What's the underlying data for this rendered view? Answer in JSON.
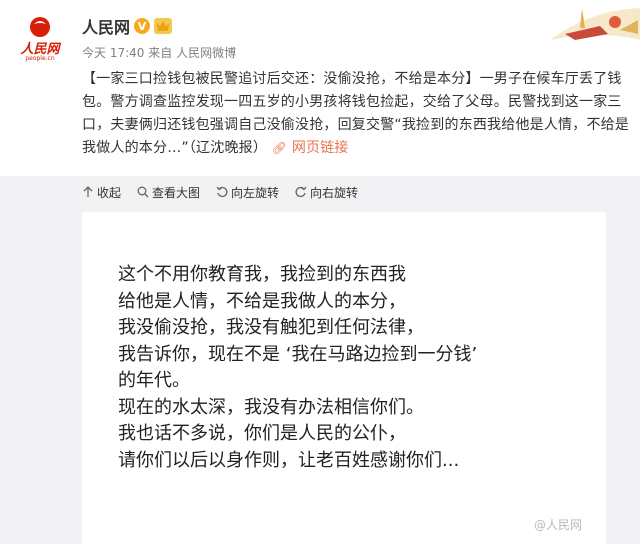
{
  "post": {
    "author": "人民网",
    "verified_badge": "V",
    "meta": {
      "time": "今天 17:40",
      "from_label": "来自",
      "source": "人民网微博"
    },
    "body_text": "【一家三口捡钱包被民警追讨后交还：没偷没抢，不给是本分】一男子在候车厅丢了钱包。警方调查监控发现一四五岁的小男孩将钱包捡起，交给了父母。民警找到这一家三口，夫妻俩归还钱包强调自己没偷没抢，回复交警“我捡到的东西我给他是人情，不给是我做人的本分…”（辽沈晚报）",
    "link_label": "网页链接"
  },
  "avatar": {
    "logo_text": "人民网",
    "logo_subtext": "people.cn"
  },
  "toolbar": {
    "collapse": "收起",
    "view_large": "查看大图",
    "rotate_left": "向左旋转",
    "rotate_right": "向右旋转"
  },
  "picture": {
    "lines": [
      "这个不用你教育我，我捡到的东西我",
      "给他是人情，不给是我做人的本分，",
      "我没偷没抢，我没有触犯到任何法律，",
      "我告诉你，现在不是 ‘我在马路边捡到一分钱’",
      "的年代。",
      "现在的水太深，我没有办法相信你们。",
      "我也话不多说，你们是人民的公仆，",
      "请你们以后以身作则，让老百姓感谢你们..."
    ],
    "watermark": "@人民网"
  },
  "colors": {
    "link": "#eb7350",
    "brand_red": "#d81e06",
    "badge": "#f7a81b"
  }
}
